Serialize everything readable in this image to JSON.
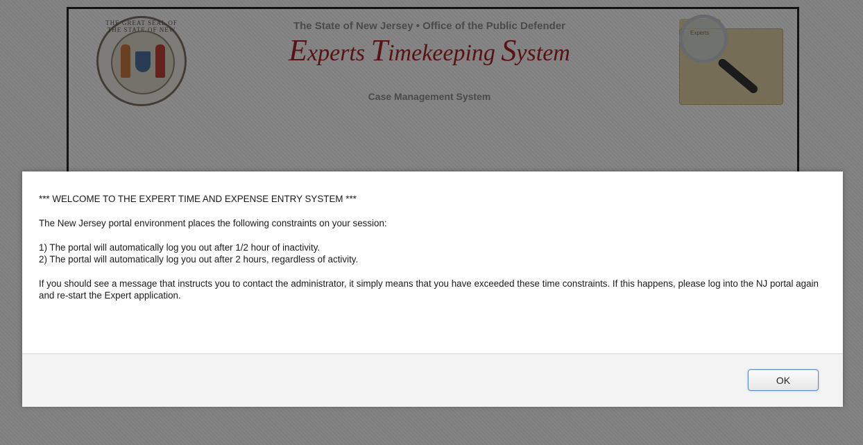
{
  "header": {
    "seal_text": "THE GREAT SEAL OF THE STATE OF NEW JERSEY",
    "subtitle": "The State of New Jersey • Office of the Public Defender",
    "title_parts": [
      "E",
      "xperts ",
      "T",
      "imekeeping ",
      "S",
      "ystem"
    ],
    "system_name": "Case Management System",
    "folder_label": "Experts"
  },
  "dialog": {
    "lines": [
      "*** WELCOME TO THE EXPERT TIME AND EXPENSE ENTRY SYSTEM ***",
      "The New Jersey portal environment places the following constraints on your session:",
      "1) The portal will automatically log you out after 1/2 hour of inactivity.",
      "2) The portal will automatically log you out after 2 hours, regardless of activity.",
      "If you should see a message that instructs you to contact the administrator, it simply means that you have exceeded these time constraints. If this happens, please log into the NJ portal again and re-start the Expert application."
    ],
    "ok_label": "OK"
  },
  "colors": {
    "title_red": "#a4202a",
    "overlay": "#000000",
    "button_border": "#5b8cc8"
  }
}
